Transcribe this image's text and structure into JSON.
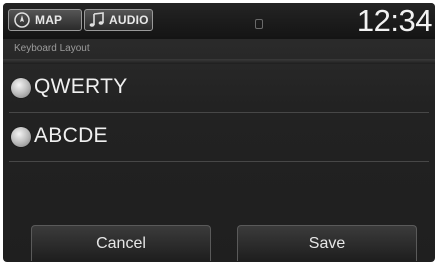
{
  "topbar": {
    "map_label": "MAP",
    "audio_label": "AUDIO",
    "clock": "12:34"
  },
  "header": {
    "title": "Keyboard Layout"
  },
  "options": [
    {
      "label": "QWERTY",
      "selected": false
    },
    {
      "label": "ABCDE",
      "selected": false
    }
  ],
  "buttons": {
    "cancel_label": "Cancel",
    "save_label": "Save"
  },
  "icons": {
    "map": "compass-icon",
    "audio": "music-note-icon",
    "status": "signal-indicator-icon"
  }
}
